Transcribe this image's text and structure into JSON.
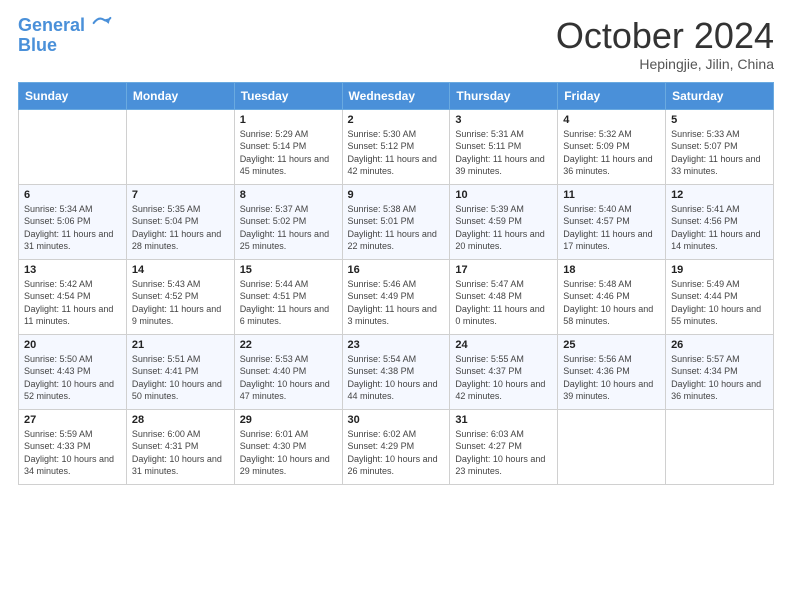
{
  "header": {
    "logo_line1": "General",
    "logo_line2": "Blue",
    "month": "October 2024",
    "location": "Hepingjie, Jilin, China"
  },
  "days_of_week": [
    "Sunday",
    "Monday",
    "Tuesday",
    "Wednesday",
    "Thursday",
    "Friday",
    "Saturday"
  ],
  "weeks": [
    [
      {
        "day": "",
        "info": ""
      },
      {
        "day": "",
        "info": ""
      },
      {
        "day": "1",
        "info": "Sunrise: 5:29 AM\nSunset: 5:14 PM\nDaylight: 11 hours and 45 minutes."
      },
      {
        "day": "2",
        "info": "Sunrise: 5:30 AM\nSunset: 5:12 PM\nDaylight: 11 hours and 42 minutes."
      },
      {
        "day": "3",
        "info": "Sunrise: 5:31 AM\nSunset: 5:11 PM\nDaylight: 11 hours and 39 minutes."
      },
      {
        "day": "4",
        "info": "Sunrise: 5:32 AM\nSunset: 5:09 PM\nDaylight: 11 hours and 36 minutes."
      },
      {
        "day": "5",
        "info": "Sunrise: 5:33 AM\nSunset: 5:07 PM\nDaylight: 11 hours and 33 minutes."
      }
    ],
    [
      {
        "day": "6",
        "info": "Sunrise: 5:34 AM\nSunset: 5:06 PM\nDaylight: 11 hours and 31 minutes."
      },
      {
        "day": "7",
        "info": "Sunrise: 5:35 AM\nSunset: 5:04 PM\nDaylight: 11 hours and 28 minutes."
      },
      {
        "day": "8",
        "info": "Sunrise: 5:37 AM\nSunset: 5:02 PM\nDaylight: 11 hours and 25 minutes."
      },
      {
        "day": "9",
        "info": "Sunrise: 5:38 AM\nSunset: 5:01 PM\nDaylight: 11 hours and 22 minutes."
      },
      {
        "day": "10",
        "info": "Sunrise: 5:39 AM\nSunset: 4:59 PM\nDaylight: 11 hours and 20 minutes."
      },
      {
        "day": "11",
        "info": "Sunrise: 5:40 AM\nSunset: 4:57 PM\nDaylight: 11 hours and 17 minutes."
      },
      {
        "day": "12",
        "info": "Sunrise: 5:41 AM\nSunset: 4:56 PM\nDaylight: 11 hours and 14 minutes."
      }
    ],
    [
      {
        "day": "13",
        "info": "Sunrise: 5:42 AM\nSunset: 4:54 PM\nDaylight: 11 hours and 11 minutes."
      },
      {
        "day": "14",
        "info": "Sunrise: 5:43 AM\nSunset: 4:52 PM\nDaylight: 11 hours and 9 minutes."
      },
      {
        "day": "15",
        "info": "Sunrise: 5:44 AM\nSunset: 4:51 PM\nDaylight: 11 hours and 6 minutes."
      },
      {
        "day": "16",
        "info": "Sunrise: 5:46 AM\nSunset: 4:49 PM\nDaylight: 11 hours and 3 minutes."
      },
      {
        "day": "17",
        "info": "Sunrise: 5:47 AM\nSunset: 4:48 PM\nDaylight: 11 hours and 0 minutes."
      },
      {
        "day": "18",
        "info": "Sunrise: 5:48 AM\nSunset: 4:46 PM\nDaylight: 10 hours and 58 minutes."
      },
      {
        "day": "19",
        "info": "Sunrise: 5:49 AM\nSunset: 4:44 PM\nDaylight: 10 hours and 55 minutes."
      }
    ],
    [
      {
        "day": "20",
        "info": "Sunrise: 5:50 AM\nSunset: 4:43 PM\nDaylight: 10 hours and 52 minutes."
      },
      {
        "day": "21",
        "info": "Sunrise: 5:51 AM\nSunset: 4:41 PM\nDaylight: 10 hours and 50 minutes."
      },
      {
        "day": "22",
        "info": "Sunrise: 5:53 AM\nSunset: 4:40 PM\nDaylight: 10 hours and 47 minutes."
      },
      {
        "day": "23",
        "info": "Sunrise: 5:54 AM\nSunset: 4:38 PM\nDaylight: 10 hours and 44 minutes."
      },
      {
        "day": "24",
        "info": "Sunrise: 5:55 AM\nSunset: 4:37 PM\nDaylight: 10 hours and 42 minutes."
      },
      {
        "day": "25",
        "info": "Sunrise: 5:56 AM\nSunset: 4:36 PM\nDaylight: 10 hours and 39 minutes."
      },
      {
        "day": "26",
        "info": "Sunrise: 5:57 AM\nSunset: 4:34 PM\nDaylight: 10 hours and 36 minutes."
      }
    ],
    [
      {
        "day": "27",
        "info": "Sunrise: 5:59 AM\nSunset: 4:33 PM\nDaylight: 10 hours and 34 minutes."
      },
      {
        "day": "28",
        "info": "Sunrise: 6:00 AM\nSunset: 4:31 PM\nDaylight: 10 hours and 31 minutes."
      },
      {
        "day": "29",
        "info": "Sunrise: 6:01 AM\nSunset: 4:30 PM\nDaylight: 10 hours and 29 minutes."
      },
      {
        "day": "30",
        "info": "Sunrise: 6:02 AM\nSunset: 4:29 PM\nDaylight: 10 hours and 26 minutes."
      },
      {
        "day": "31",
        "info": "Sunrise: 6:03 AM\nSunset: 4:27 PM\nDaylight: 10 hours and 23 minutes."
      },
      {
        "day": "",
        "info": ""
      },
      {
        "day": "",
        "info": ""
      }
    ]
  ]
}
